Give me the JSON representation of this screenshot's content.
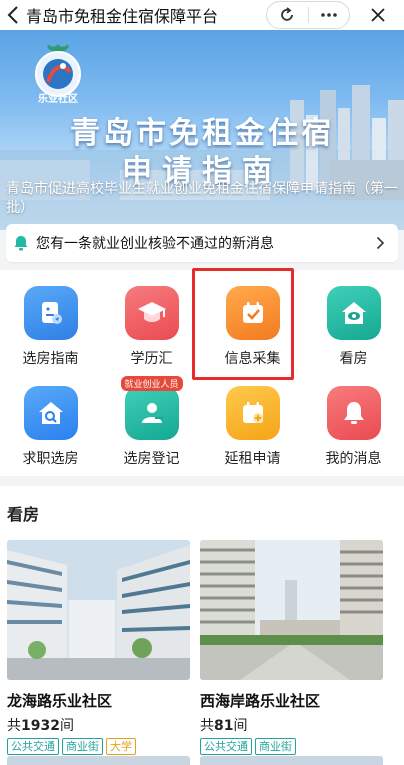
{
  "titlebar": {
    "title": "青岛市免租金住宿保障平台",
    "back_icon": "chevron-left-icon",
    "refresh_icon": "refresh-icon",
    "more_icon": "more-dots-icon",
    "close_icon": "close-icon"
  },
  "banner": {
    "logo_text": "乐业社区",
    "heading_line1": "青岛市免租金住宿",
    "heading_line2": "申请指南",
    "subtitle": "青岛市促进高校毕业生就业创业免租金住宿保障申请指南（第一批）"
  },
  "notice": {
    "text": "您有一条就业创业核验不通过的新消息",
    "icon": "bell-icon"
  },
  "grid": {
    "items": [
      {
        "label": "选房指南",
        "icon": "guide-icon",
        "color": "#3d8cf0"
      },
      {
        "label": "学历汇",
        "icon": "graduation-cap-icon",
        "color": "#f0585d"
      },
      {
        "label": "信息采集",
        "icon": "calendar-check-icon",
        "color": "#f7902e"
      },
      {
        "label": "看房",
        "icon": "house-eye-icon",
        "color": "#1fb5a0"
      },
      {
        "label": "求职选房",
        "icon": "house-search-icon",
        "color": "#2e8ef0"
      },
      {
        "label": "选房登记",
        "icon": "person-register-icon",
        "color": "#1fb5a0",
        "badge": "就业创业人员"
      },
      {
        "label": "延租申请",
        "icon": "calendar-plus-icon",
        "color": "#f7b42e"
      },
      {
        "label": "我的消息",
        "icon": "bell-alert-icon",
        "color": "#f0585d"
      }
    ]
  },
  "section": {
    "title": "看房",
    "cards": [
      {
        "name": "龙海路乐业社区",
        "count_prefix": "共",
        "count": "1932",
        "count_suffix": "间",
        "tags": [
          "公共交通",
          "商业街",
          "大学"
        ]
      },
      {
        "name": "西海岸路乐业社区",
        "count_prefix": "共",
        "count": "81",
        "count_suffix": "间",
        "tags": [
          "公共交通",
          "商业街"
        ]
      }
    ]
  },
  "colors": {
    "highlight": "#e62b2b",
    "tag_teal": "#24a39c",
    "tag_gold": "#e3a21a"
  }
}
